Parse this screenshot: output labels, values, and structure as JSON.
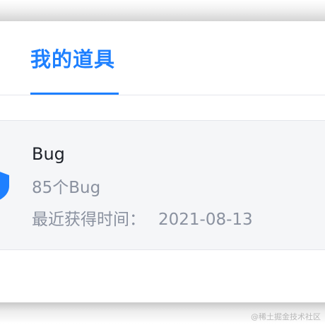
{
  "tabs": [
    {
      "label": "我的道具",
      "active": true
    }
  ],
  "items": [
    {
      "title": "Bug",
      "count_text": "85个Bug",
      "time_label": "最近获得时间：",
      "time_value": "2021-08-13",
      "icon": "shield-icon"
    }
  ],
  "watermark": "@稀土掘金技术社区",
  "colors": {
    "accent": "#1e80ff",
    "text_primary": "#1d2129",
    "text_secondary": "#8a919f",
    "item_background": "#f5f6f8"
  }
}
